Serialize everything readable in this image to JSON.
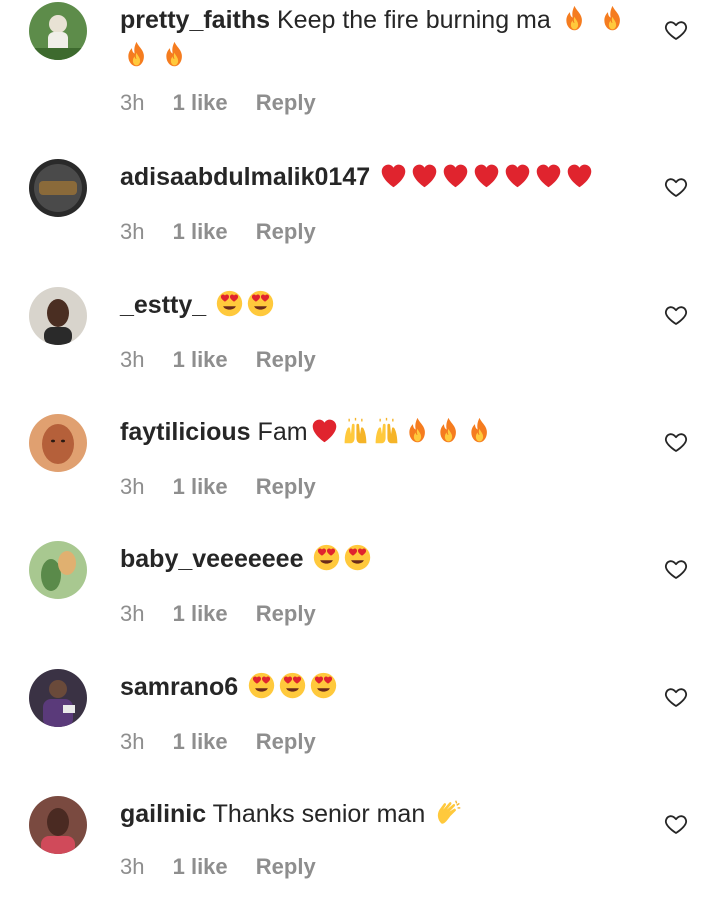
{
  "comments": [
    {
      "username": "pretty_faiths",
      "text": "Keep the fire burning ma",
      "emojis": [
        "fire-icon",
        "fire-icon",
        "fire-icon",
        "fire-icon"
      ],
      "time": "3h",
      "likes": "1 like",
      "reply": "Reply",
      "avatar_color": "#4a7a3a"
    },
    {
      "username": "adisaabdulmalik0147",
      "text": "",
      "emojis": [
        "red-heart-icon",
        "red-heart-icon",
        "red-heart-icon",
        "red-heart-icon",
        "red-heart-icon",
        "red-heart-icon",
        "red-heart-icon"
      ],
      "time": "3h",
      "likes": "1 like",
      "reply": "Reply",
      "avatar_color": "#3a3a3a"
    },
    {
      "username": "_estty_",
      "text": "",
      "emojis": [
        "heart-eyes-icon",
        "heart-eyes-icon"
      ],
      "time": "3h",
      "likes": "1 like",
      "reply": "Reply",
      "avatar_color": "#c9c4bd"
    },
    {
      "username": "faytilicious",
      "text": "Fam",
      "emojis": [
        "red-heart-icon",
        "raised-hands-icon",
        "raised-hands-icon",
        "fire-icon",
        "fire-icon",
        "fire-icon"
      ],
      "time": "3h",
      "likes": "1 like",
      "reply": "Reply",
      "avatar_color": "#c8764a"
    },
    {
      "username": "baby_veeeeeee",
      "text": "",
      "emojis": [
        "heart-eyes-icon",
        "heart-eyes-icon"
      ],
      "time": "3h",
      "likes": "1 like",
      "reply": "Reply",
      "avatar_color": "#7aa06a"
    },
    {
      "username": "samrano6",
      "text": "",
      "emojis": [
        "heart-eyes-icon",
        "heart-eyes-icon",
        "heart-eyes-icon"
      ],
      "time": "3h",
      "likes": "1 like",
      "reply": "Reply",
      "avatar_color": "#5a4c6a"
    },
    {
      "username": "gailinic",
      "text": "Thanks senior man",
      "emojis": [
        "clapping-hands-icon"
      ],
      "time": "3h",
      "likes": "1 like",
      "reply": "Reply",
      "avatar_color": "#6e3a34"
    }
  ],
  "colors": {
    "text": "#262626",
    "secondary": "#8e8e8e",
    "heart_red": "#e0242e",
    "fire_orange": "#f57c1f",
    "emoji_yellow": "#ffc93c"
  }
}
